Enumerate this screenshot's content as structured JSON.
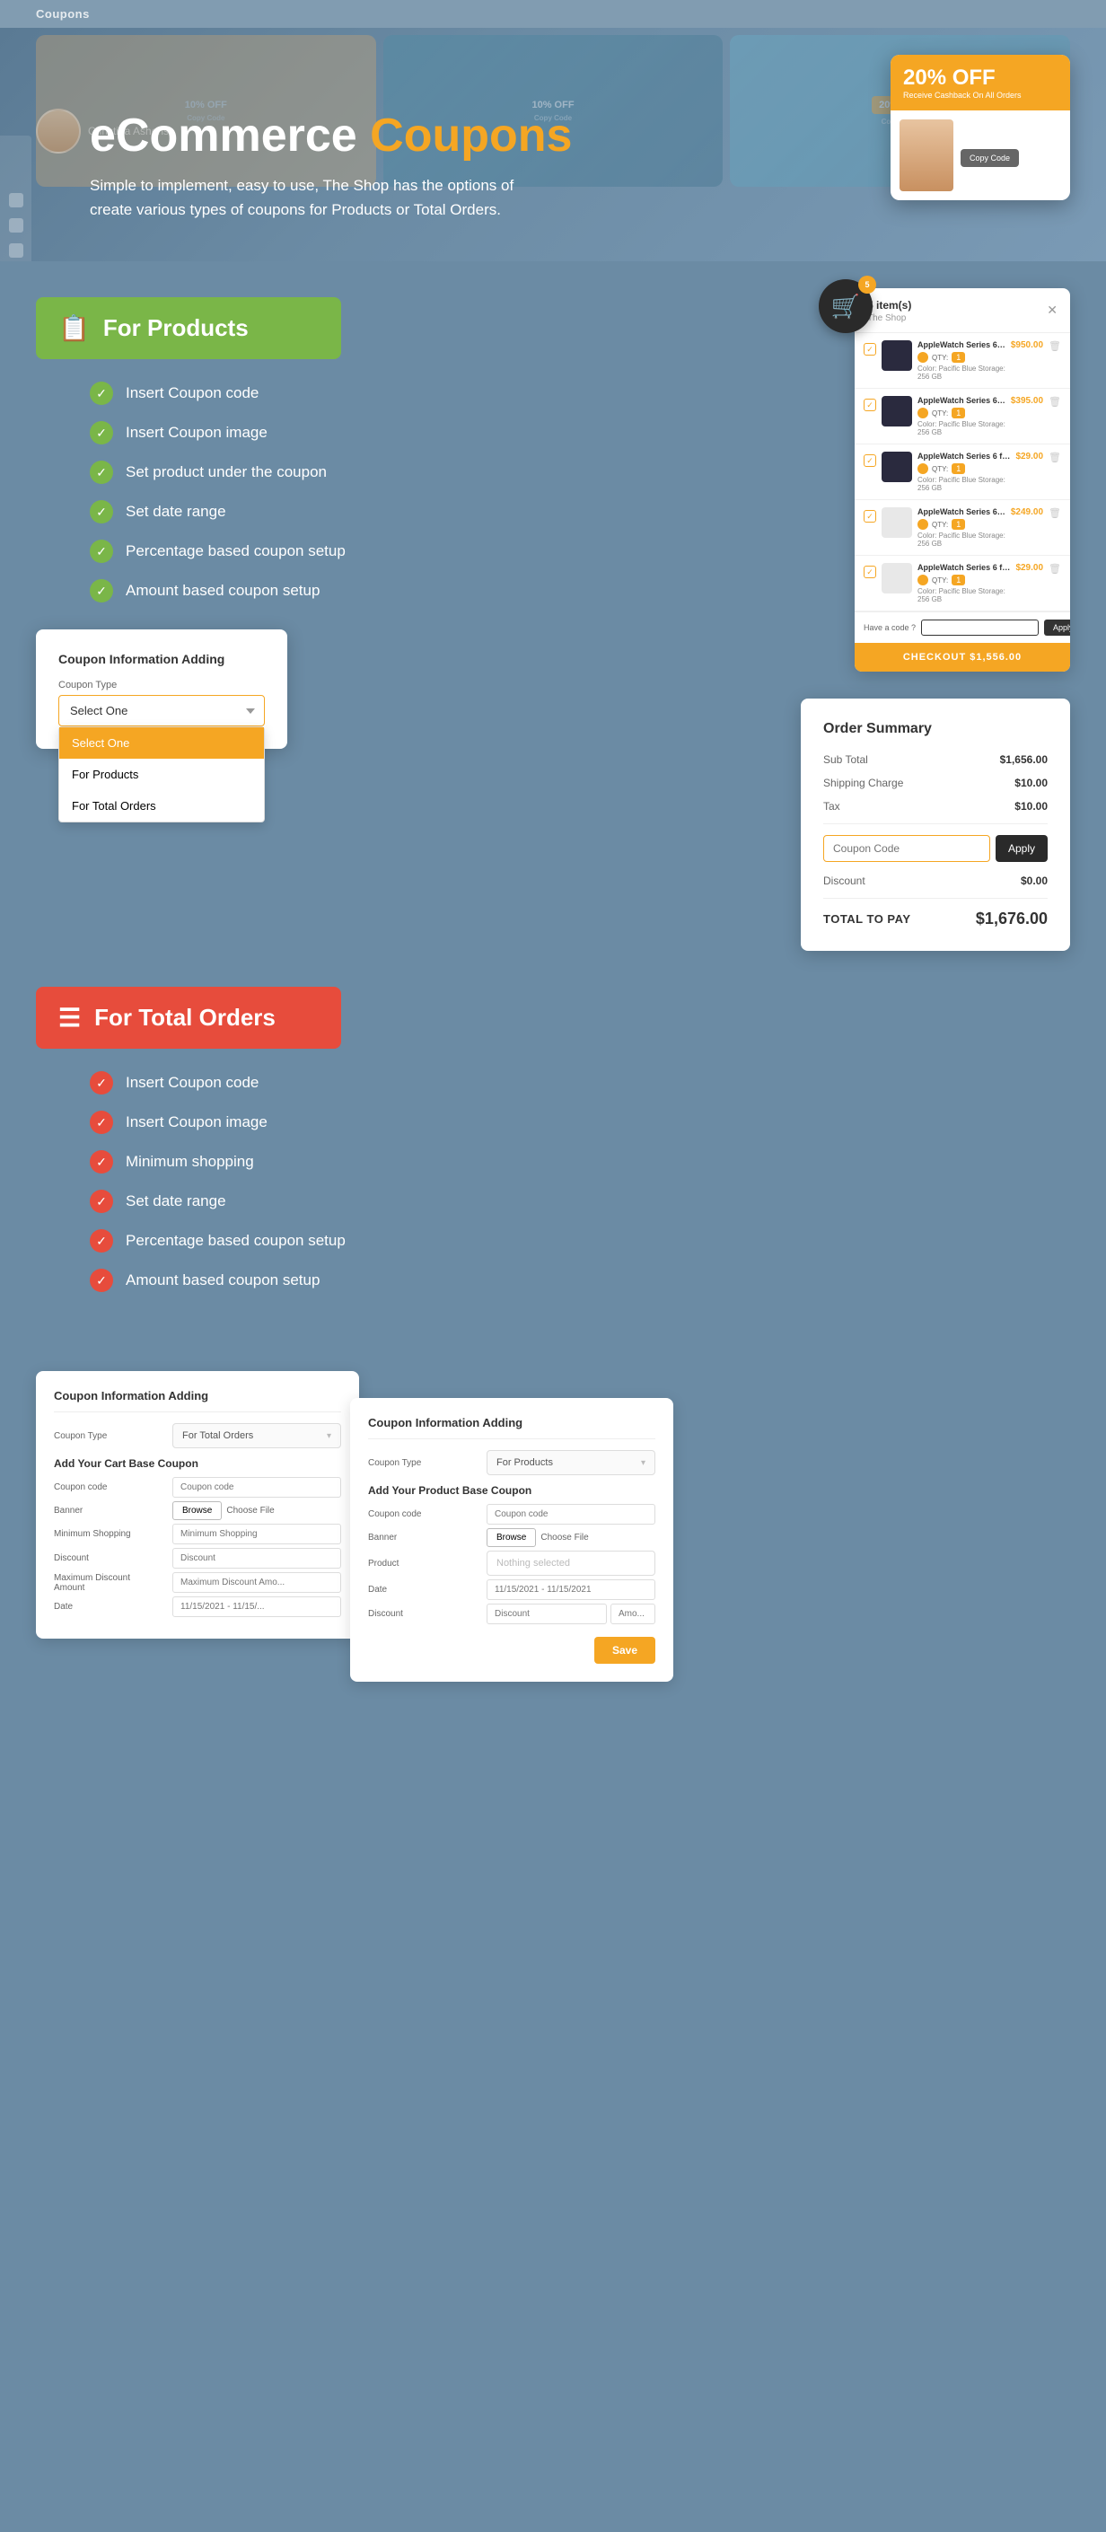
{
  "page": {
    "topbar_label": "Coupons",
    "hero": {
      "title_white": "eCommerce",
      "title_orange": "Coupons",
      "subtitle": "Simple to implement, easy to use, The Shop has the options of create various types of coupons for Products or Total Orders.",
      "profile_name": "Christina Ashens"
    },
    "promo_card": {
      "percent": "20% OFF",
      "description": "Receive Cashback On All Orders",
      "copy_label": "Copy Code"
    },
    "for_products_section": {
      "label": "For Products",
      "features": [
        "Insert Coupon code",
        "Insert Coupon image",
        "Set product under the coupon",
        "Set date range",
        "Percentage based coupon setup",
        "Amount based coupon setup"
      ]
    },
    "for_total_orders_section": {
      "label": "For Total Orders",
      "features": [
        "Insert Coupon code",
        "Insert Coupon image",
        "Minimum shopping",
        "Set date range",
        "Percentage based coupon setup",
        "Amount based coupon setup"
      ]
    },
    "coupon_info_card_small": {
      "title": "Coupon Information Adding",
      "coupon_type_label": "Coupon Type",
      "select_placeholder": "Select One",
      "dropdown": {
        "items": [
          {
            "label": "Select One",
            "active": true
          },
          {
            "label": "For Products"
          },
          {
            "label": "For Total Orders"
          }
        ]
      }
    },
    "cart": {
      "header": "5 item(s)",
      "shop_name": "The Shop",
      "items": [
        {
          "name": "AppleWatch Series 6 from..",
          "qty": 1,
          "price": "$950.00",
          "color": "Pacific Blue",
          "storage": "256 GB",
          "dark": true
        },
        {
          "name": "AppleWatch Series 6 from..",
          "qty": 1,
          "price": "$395.00",
          "color": "Pacific Blue",
          "storage": "256 GB",
          "dark": true
        },
        {
          "name": "AppleWatch Series 6 from..",
          "qty": 1,
          "price": "$29.00",
          "color": "Pacific Blue",
          "storage": "256 GB",
          "dark": true
        },
        {
          "name": "AppleWatch Series 6 from..",
          "qty": 1,
          "price": "$249.00",
          "color": "Pacific Blue",
          "storage": "256 GB",
          "dark": false
        },
        {
          "name": "AppleWatch Series 6 from..",
          "qty": 1,
          "price": "$29.00",
          "color": "Pacific Blue",
          "storage": "256 GB",
          "dark": false
        }
      ],
      "coupon_label": "Have a code ?",
      "coupon_placeholder": "",
      "apply_label": "Apply",
      "checkout_label": "CHECKOUT  $1,556.00"
    },
    "order_summary": {
      "title": "Order Summary",
      "subtotal_label": "Sub Total",
      "subtotal_value": "$1,656.00",
      "shipping_label": "Shipping Charge",
      "shipping_value": "$10.00",
      "tax_label": "Tax",
      "tax_value": "$10.00",
      "coupon_placeholder": "Coupon Code",
      "apply_label": "Apply",
      "discount_label": "Discount",
      "discount_value": "$0.00",
      "total_label": "TOTAL TO PAY",
      "total_value": "$1,676.00"
    },
    "form_total_orders": {
      "title": "Coupon Information Adding",
      "coupon_type_label": "Coupon Type",
      "coupon_type_value": "For Total Orders",
      "section_label": "Add Your Cart Base Coupon",
      "fields": [
        {
          "label": "Coupon code",
          "placeholder": "Coupon code"
        },
        {
          "label": "Banner",
          "type": "browse",
          "browse_label": "Browse",
          "choose_label": "Choose File"
        },
        {
          "label": "Minimum Shopping",
          "placeholder": "Minimum Shopping"
        },
        {
          "label": "Discount",
          "placeholder": "Discount"
        },
        {
          "label": "Maximum Discount Amount",
          "placeholder": "Maximum Discount Amo..."
        },
        {
          "label": "Date",
          "placeholder": "11/15/2021 - 11/15/..."
        }
      ]
    },
    "form_products": {
      "title": "Coupon Information Adding",
      "coupon_type_label": "Coupon Type",
      "coupon_type_value": "For Products",
      "section_label": "Add Your Product Base Coupon",
      "fields": [
        {
          "label": "Coupon code",
          "placeholder": "Coupon code"
        },
        {
          "label": "Banner",
          "type": "browse",
          "browse_label": "Browse",
          "choose_label": "Choose File"
        },
        {
          "label": "Product",
          "placeholder": "Nothing selected"
        },
        {
          "label": "Date",
          "placeholder": "11/15/2021 - 11/15/2021"
        },
        {
          "label": "Discount",
          "type": "double",
          "placeholder1": "Discount",
          "placeholder2": "Amo..."
        }
      ],
      "save_label": "Save"
    },
    "colors": {
      "orange": "#f5a623",
      "green": "#7ab648",
      "red": "#e74c3c",
      "dark_bg": "#6b8ba4"
    }
  }
}
